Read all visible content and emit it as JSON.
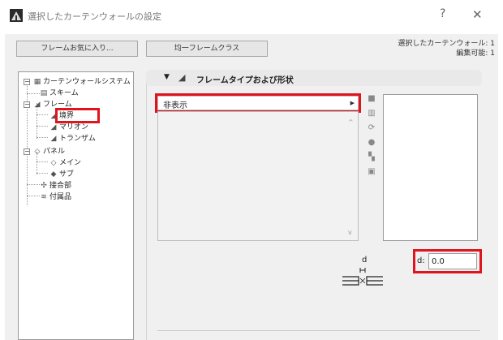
{
  "window": {
    "title": "選択したカーテンウォールの設定",
    "help_label": "?",
    "close_label": "✕",
    "icon": "app-icon"
  },
  "toolbar": {
    "favorites_label": "フレームお気に入り...",
    "class_label": "均一フレームクラス",
    "selected_line": "選択したカーテンウォール: 1",
    "editable_line": "編集可能: 1"
  },
  "tree": {
    "items": [
      {
        "label": "カーテンウォールシステム",
        "icon": "curtain-wall-icon"
      },
      {
        "label": "スキーム",
        "icon": "scheme-icon"
      },
      {
        "label": "フレーム",
        "icon": "frame-icon"
      },
      {
        "label": "境界",
        "icon": "boundary-frame-icon"
      },
      {
        "label": "マリオン",
        "icon": "mullion-icon"
      },
      {
        "label": "トランザム",
        "icon": "transom-icon"
      },
      {
        "label": "パネル",
        "icon": "panel-icon"
      },
      {
        "label": "メイン",
        "icon": "main-panel-icon"
      },
      {
        "label": "サブ",
        "icon": "sub-panel-icon"
      },
      {
        "label": "接合部",
        "icon": "junction-icon"
      },
      {
        "label": "付属品",
        "icon": "accessory-icon"
      }
    ],
    "selected_index": 3
  },
  "section": {
    "title": "フレームタイプおよび形状",
    "icon": "frame-type-icon"
  },
  "frame_type": {
    "selected": "非表示"
  },
  "dimension": {
    "diagram_label": "d",
    "field_label": "d:",
    "value": "0.0"
  },
  "colors": {
    "highlight": "#e0141e",
    "panel_bg": "#f0f0f0"
  }
}
